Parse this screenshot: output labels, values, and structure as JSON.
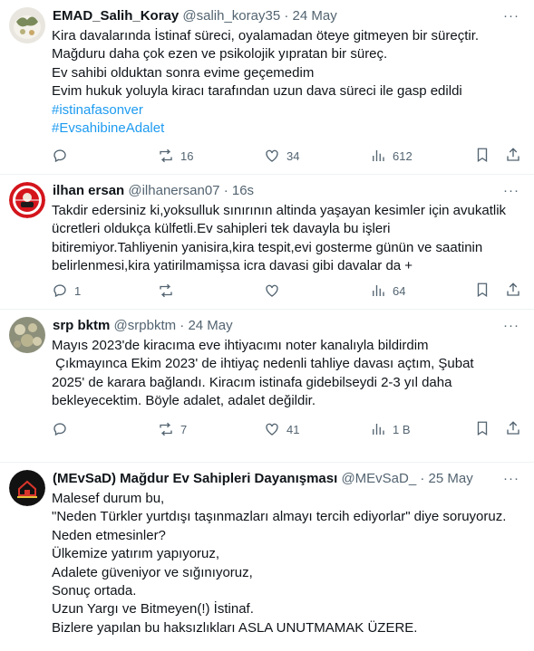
{
  "tweets": [
    {
      "name": "EMAD_Salih_Koray",
      "handle": "@salih_koray35",
      "dot": "·",
      "time": "24 May",
      "more": "···",
      "lines": [
        "Kira davalarında İstinaf süreci, oyalamadan öteye gitmeyen bir süreçtir.",
        "Mağduru daha çok ezen ve psikolojik yıpratan bir süreç.",
        "Ev sahibi olduktan sonra evime geçemedim",
        "Evim hukuk yoluyla kiracı tarafından uzun dava süreci ile gasp edildi"
      ],
      "hashtags": [
        "#istinafasonver",
        "#EvsahibineAdalet"
      ],
      "replies": "",
      "reposts": "16",
      "likes": "34",
      "views": "612"
    },
    {
      "name": "ilhan ersan",
      "handle": "@ilhanersan07",
      "dot": "·",
      "time": "16s",
      "more": "···",
      "lines": [
        "Takdir edersiniz ki,yoksulluk sınırının altinda yaşayan kesimler için avukatlik",
        "ücretleri oldukça külfetli.Ev sahipleri tek davayla bu işleri",
        "bitiremiyor.Tahliyenin yanisira,kira tespit,evi gosterme günün ve saatinin",
        "belirlenmesi,kira yatirilmamişsa icra davasi gibi davalar da +"
      ],
      "replies": "1",
      "reposts": "",
      "likes": "",
      "views": "64"
    },
    {
      "name": "srp bktm",
      "handle": "@srpbktm",
      "dot": "·",
      "time": "24 May",
      "more": "···",
      "lines": [
        "Mayıs 2023'de kiracıma eve ihtiyacımı noter kanalıyla bildirdim",
        " Çıkmayınca Ekim 2023' de ihtiyaç nedenli tahliye davası açtım, Şubat",
        "2025' de karara bağlandı. Kiracım istinafa gidebilseydi 2-3 yıl daha",
        "bekleyecektim. Böyle adalet, adalet değildir."
      ],
      "replies": "",
      "reposts": "7",
      "likes": "41",
      "views": "1 B"
    },
    {
      "name": "(MEvSaD) Mağdur Ev Sahipleri Dayanışması",
      "handle": "@MEvSaD_",
      "dot": "·",
      "time": "25 May",
      "more": "···",
      "lines": [
        "Malesef durum bu,",
        "\"Neden Türkler yurtdışı taşınmazları almayı tercih ediyorlar\" diye soruyoruz.",
        "Neden etmesinler?",
        "Ülkemize yatırım yapıyoruz,",
        "Adalete güveniyor ve sığınıyoruz,",
        "Sonuç ortada.",
        "Uzun Yargı ve Bitmeyen(!) İstinaf.",
        "Bizlere yapılan bu haksızlıkları ASLA UNUTMAMAK ÜZERE."
      ]
    }
  ]
}
